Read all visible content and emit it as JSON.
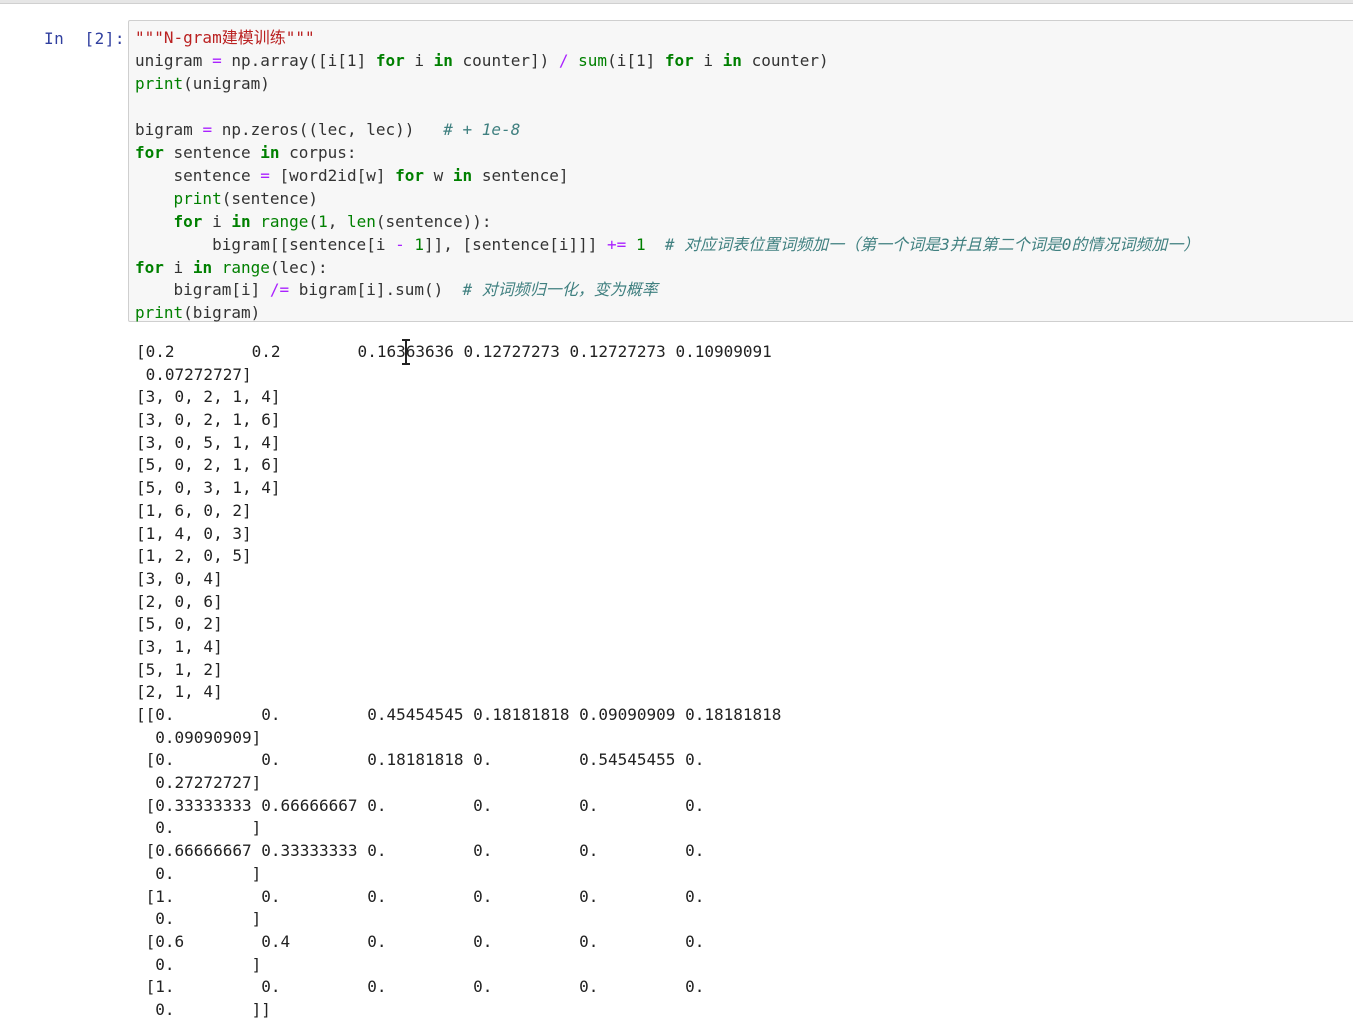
{
  "cell": {
    "prompt": "In  [2]:",
    "code": {
      "l1_docstring": "\"\"\"N-gram建模训练\"\"\"",
      "l2": {
        "a": "unigram ",
        "eq": "=",
        "b": " np.array([i[1] ",
        "kw1": "for",
        "c": " i ",
        "kw2": "in",
        "d": " counter]) ",
        "div": "/",
        "sp": " ",
        "fn": "sum",
        "e": "(i[1] ",
        "kw3": "for",
        "f": " i ",
        "kw4": "in",
        "g": " counter)"
      },
      "l3": {
        "fn": "print",
        "a": "(unigram)"
      },
      "l5": {
        "a": "bigram ",
        "eq": "=",
        "b": " np.zeros((lec, lec))   ",
        "comment": "# + 1e-8"
      },
      "l6": {
        "kw1": "for",
        "a": " sentence ",
        "kw2": "in",
        "b": " corpus:"
      },
      "l7": {
        "a": "    sentence ",
        "eq": "=",
        "b": " [word2id[w] ",
        "kw1": "for",
        "c": " w ",
        "kw2": "in",
        "d": " sentence]"
      },
      "l8": {
        "indent": "    ",
        "fn": "print",
        "a": "(sentence)"
      },
      "l9": {
        "indent": "    ",
        "kw1": "for",
        "a": " i ",
        "kw2": "in",
        "sp": " ",
        "fn1": "range",
        "b": "(",
        "num": "1",
        "c": ", ",
        "fn2": "len",
        "d": "(sentence)):"
      },
      "l10": {
        "a": "        bigram[[sentence[i ",
        "minus": "-",
        "sp": " ",
        "num": "1",
        "b": "]], [sentence[i]]] ",
        "op": "+=",
        "c": " ",
        "num2": "1",
        "d": "  ",
        "comment": "# 对应词表位置词频加一（第一个词是3并且第二个词是0的情况词频加一）"
      },
      "l11": {
        "kw1": "for",
        "a": " i ",
        "kw2": "in",
        "sp": " ",
        "fn": "range",
        "b": "(lec):"
      },
      "l12": {
        "a": "    bigram[i] ",
        "op": "/=",
        "b": " bigram[i].sum()  ",
        "comment": "# 对词频归一化，变为概率"
      },
      "l13": {
        "fn": "print",
        "a": "(bigram)"
      }
    },
    "output": [
      "[0.2        0.2        0.16363636 0.12727273 0.12727273 0.10909091",
      " 0.07272727]",
      "[3, 0, 2, 1, 4]",
      "[3, 0, 2, 1, 6]",
      "[3, 0, 5, 1, 4]",
      "[5, 0, 2, 1, 6]",
      "[5, 0, 3, 1, 4]",
      "[1, 6, 0, 2]",
      "[1, 4, 0, 3]",
      "[1, 2, 0, 5]",
      "[3, 0, 4]",
      "[2, 0, 6]",
      "[5, 0, 2]",
      "[3, 1, 4]",
      "[5, 1, 2]",
      "[2, 1, 4]",
      "[[0.         0.         0.45454545 0.18181818 0.09090909 0.18181818",
      "  0.09090909]",
      " [0.         0.         0.18181818 0.         0.54545455 0.",
      "  0.27272727]",
      " [0.33333333 0.66666667 0.         0.         0.         0.",
      "  0.        ]",
      " [0.66666667 0.33333333 0.         0.         0.         0.",
      "  0.        ]",
      " [1.         0.         0.         0.         0.         0.",
      "  0.        ]",
      " [0.6        0.4        0.         0.         0.         0.",
      "  0.        ]",
      " [1.         0.         0.         0.         0.         0.",
      "  0.        ]]"
    ]
  },
  "colors": {
    "keyword": "#008000",
    "operator": "#aa22ff",
    "string": "#ba2121",
    "comment": "#408080",
    "prompt": "#303f9f",
    "input_bg": "#f7f7f7"
  },
  "icons": {
    "cursor": "text-cursor-icon"
  }
}
